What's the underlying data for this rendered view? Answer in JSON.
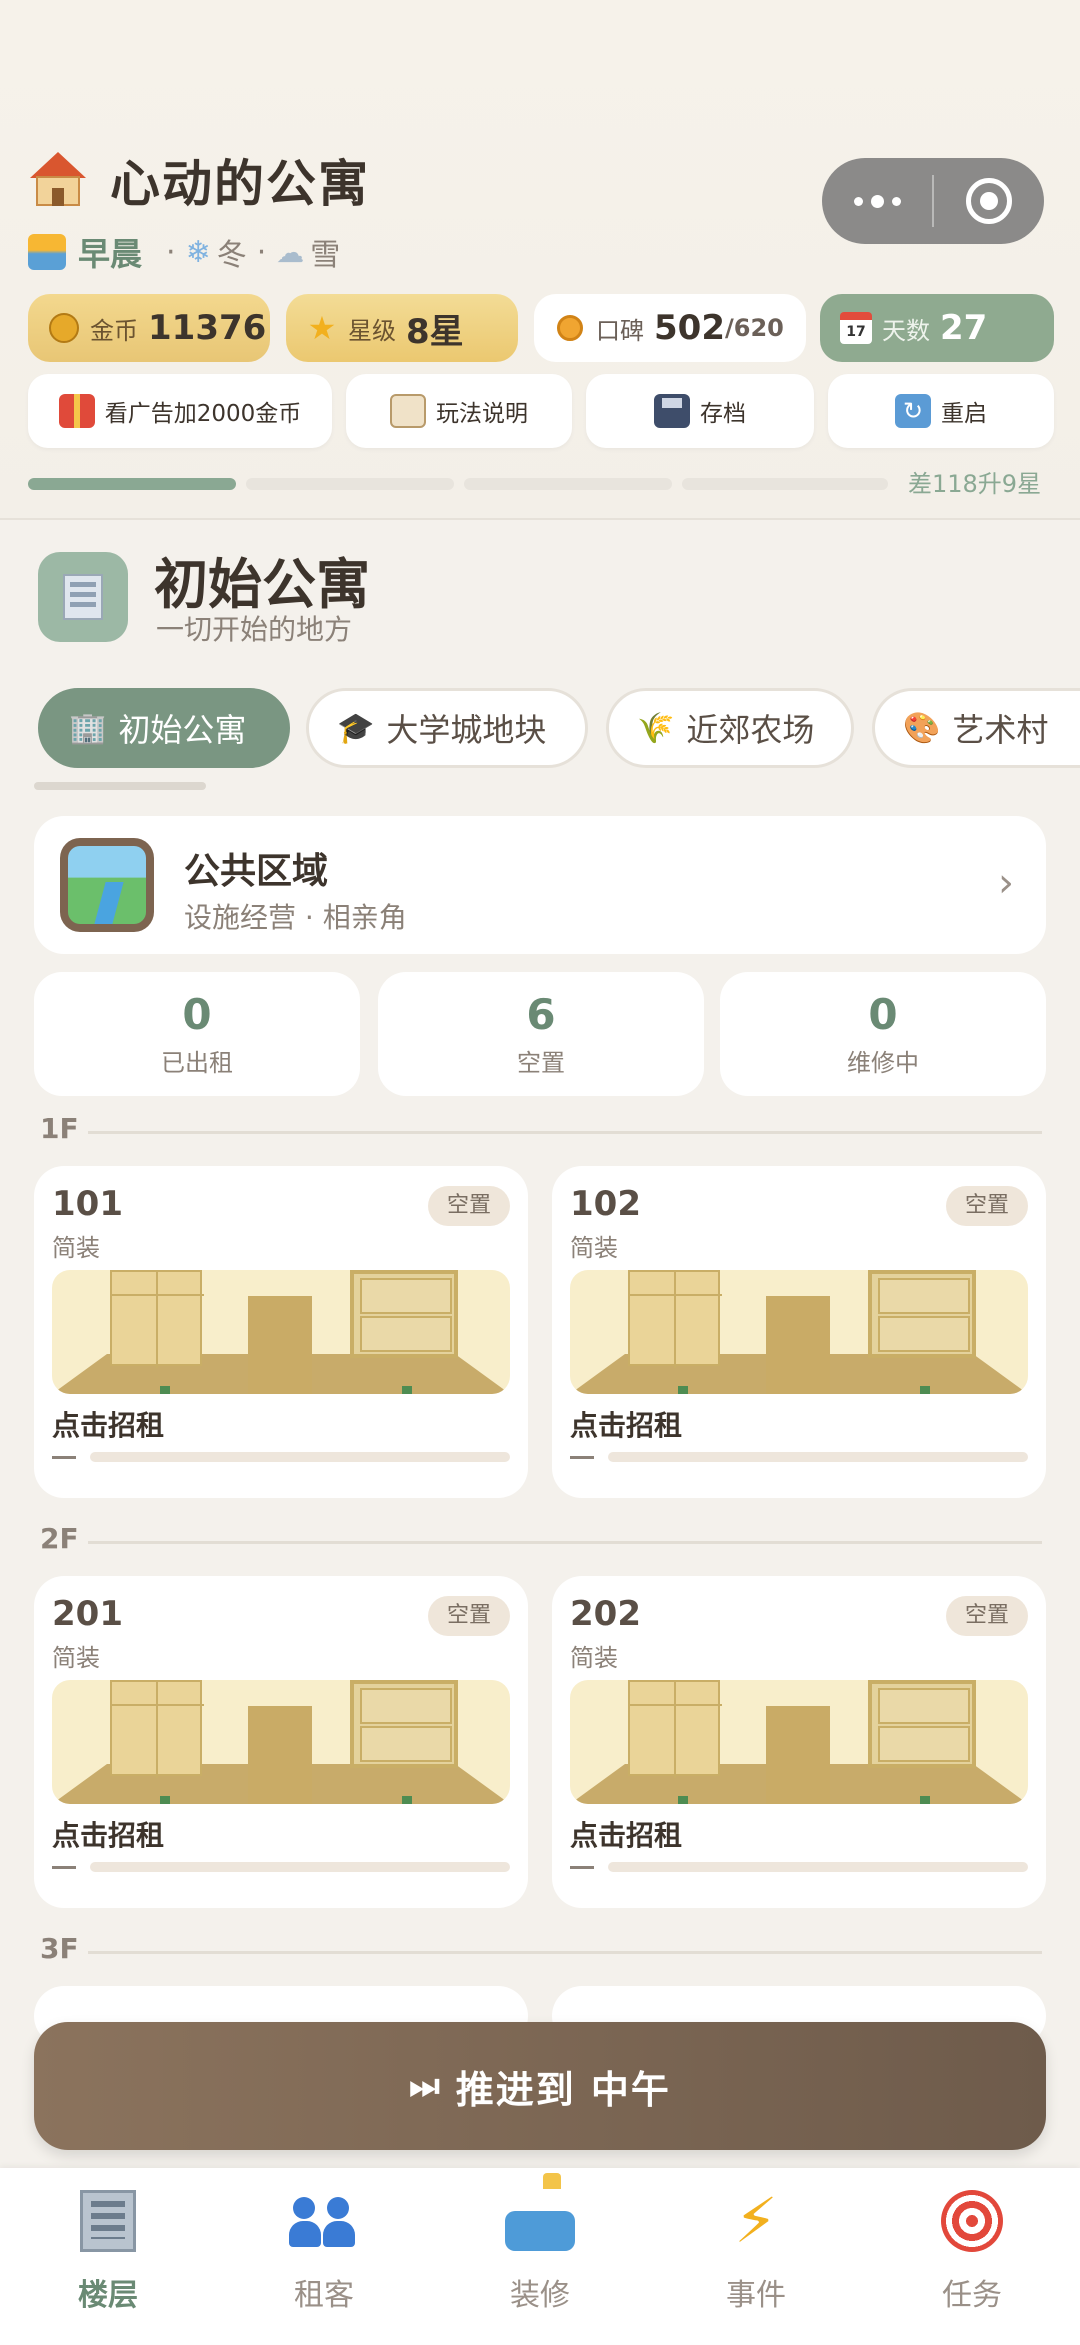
{
  "app": {
    "title": "心动的公寓",
    "status": {
      "time_of_day": "早晨",
      "season": "冬",
      "weather": "雪",
      "separator": "·"
    }
  },
  "stats": {
    "gold": {
      "label": "金币",
      "value": "11376",
      "icon": "coin-icon"
    },
    "star": {
      "label": "星级",
      "value": "8星",
      "icon": "star-icon"
    },
    "reputation": {
      "label": "口碑",
      "value": "502",
      "max": "/620",
      "icon": "medal-icon"
    },
    "days": {
      "label": "天数",
      "value": "27",
      "icon": "calendar-icon",
      "calendar_day": "17"
    }
  },
  "actions": {
    "ad_label": "看广告加2000金币",
    "guide_label": "玩法说明",
    "save_label": "存档",
    "restart_label": "重启"
  },
  "progress": {
    "text": "差118升9星",
    "segments_filled": 1,
    "segments_total": 4
  },
  "building": {
    "title": "初始公寓",
    "subtitle": "一切开始的地方"
  },
  "tabs": [
    {
      "label": "初始公寓",
      "icon": "building-icon",
      "active": true
    },
    {
      "label": "大学城地块",
      "icon": "graduation-cap-icon",
      "active": false
    },
    {
      "label": "近郊农场",
      "icon": "wheat-icon",
      "active": false
    },
    {
      "label": "艺术村",
      "icon": "palette-icon",
      "active": false
    }
  ],
  "public_area": {
    "title": "公共区域",
    "subtitle": "设施经营 · 相亲角",
    "chevron": "›"
  },
  "counters": [
    {
      "value": "0",
      "label": "已出租"
    },
    {
      "value": "6",
      "label": "空置"
    },
    {
      "value": "0",
      "label": "维修中"
    }
  ],
  "floors": [
    {
      "label": "1F",
      "rooms": [
        {
          "number": "101",
          "type": "简装",
          "badge": "空置",
          "cta": "点击招租"
        },
        {
          "number": "102",
          "type": "简装",
          "badge": "空置",
          "cta": "点击招租"
        }
      ]
    },
    {
      "label": "2F",
      "rooms": [
        {
          "number": "201",
          "type": "简装",
          "badge": "空置",
          "cta": "点击招租"
        },
        {
          "number": "202",
          "type": "简装",
          "badge": "空置",
          "cta": "点击招租"
        }
      ]
    },
    {
      "label": "3F",
      "rooms": []
    }
  ],
  "advance_button": {
    "label": "推进到 中午",
    "icon": "fast-forward-icon"
  },
  "bottom_nav": [
    {
      "label": "楼层",
      "icon": "building-icon",
      "active": true
    },
    {
      "label": "租客",
      "icon": "people-icon",
      "active": false
    },
    {
      "label": "装修",
      "icon": "sofa-icon",
      "active": false
    },
    {
      "label": "事件",
      "icon": "lightning-icon",
      "active": false
    },
    {
      "label": "任务",
      "icon": "target-icon",
      "active": false
    }
  ],
  "colors": {
    "accent_green": "#7a9682",
    "brown_button": "#7d6855",
    "gold_pill": "#ebcb7b"
  }
}
